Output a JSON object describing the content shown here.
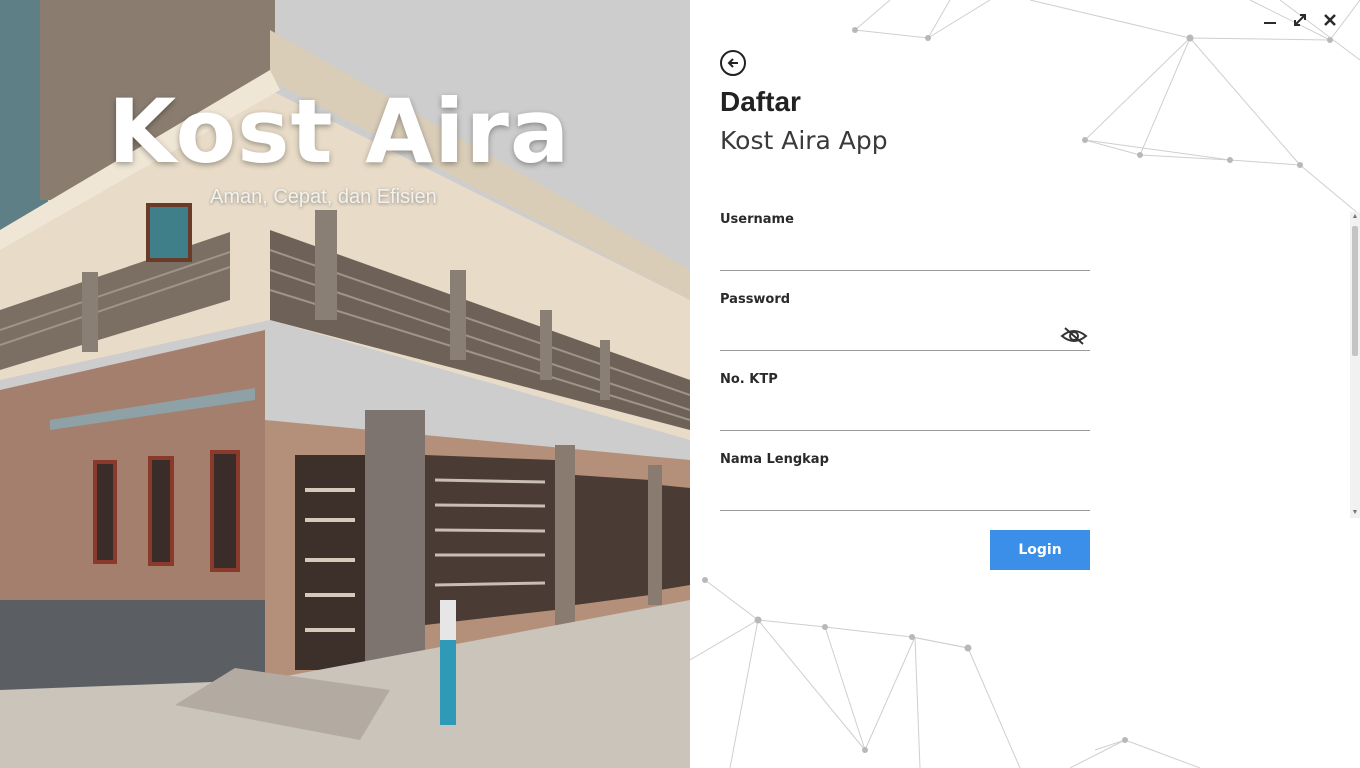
{
  "hero": {
    "title": "Kost Aira",
    "tagline": "Aman, Cepat, dan Efisien"
  },
  "window": {
    "minimize_icon": "minimize-icon",
    "maximize_icon": "maximize-icon",
    "close_icon": "close-icon"
  },
  "form": {
    "back_icon": "arrow-left-icon",
    "title": "Daftar",
    "subtitle": "Kost Aira App",
    "fields": [
      {
        "label": "Username",
        "value": ""
      },
      {
        "label": "Password",
        "value": ""
      },
      {
        "label": "No. KTP",
        "value": ""
      },
      {
        "label": "Nama Lengkap",
        "value": ""
      }
    ],
    "password_toggle_icon": "eye-slash-icon",
    "submit_label": "Login"
  },
  "colors": {
    "accent": "#3b8fe8",
    "text": "#222222",
    "underline": "#9a9a9a"
  }
}
